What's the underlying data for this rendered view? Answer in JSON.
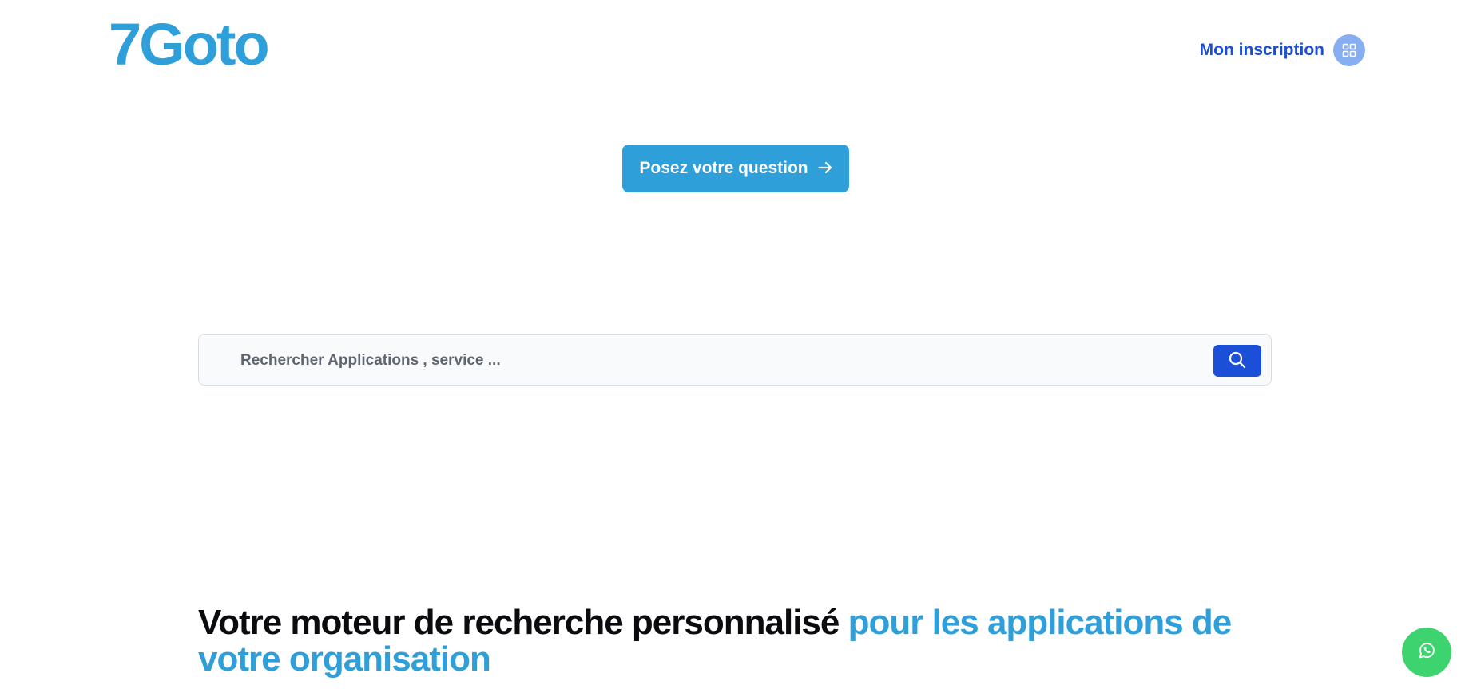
{
  "header": {
    "logo_text": "7Goto",
    "signup_label": "Mon inscription",
    "signup_icon": "grid-icon"
  },
  "ask": {
    "label": "Posez votre question",
    "icon": "arrow-right-icon"
  },
  "search": {
    "placeholder": "Rechercher Applications , service ...",
    "value": "",
    "button_icon": "search-icon"
  },
  "hero": {
    "headline_main": "Votre moteur de recherche personnalisé ",
    "headline_accent": "pour les applications de votre organisation"
  },
  "chat": {
    "icon": "whatsapp-icon"
  },
  "colors": {
    "brand": "#2e9fd9",
    "link": "#1c4fcf",
    "search_button": "#1c4fd8",
    "whatsapp": "#3dd36f"
  }
}
